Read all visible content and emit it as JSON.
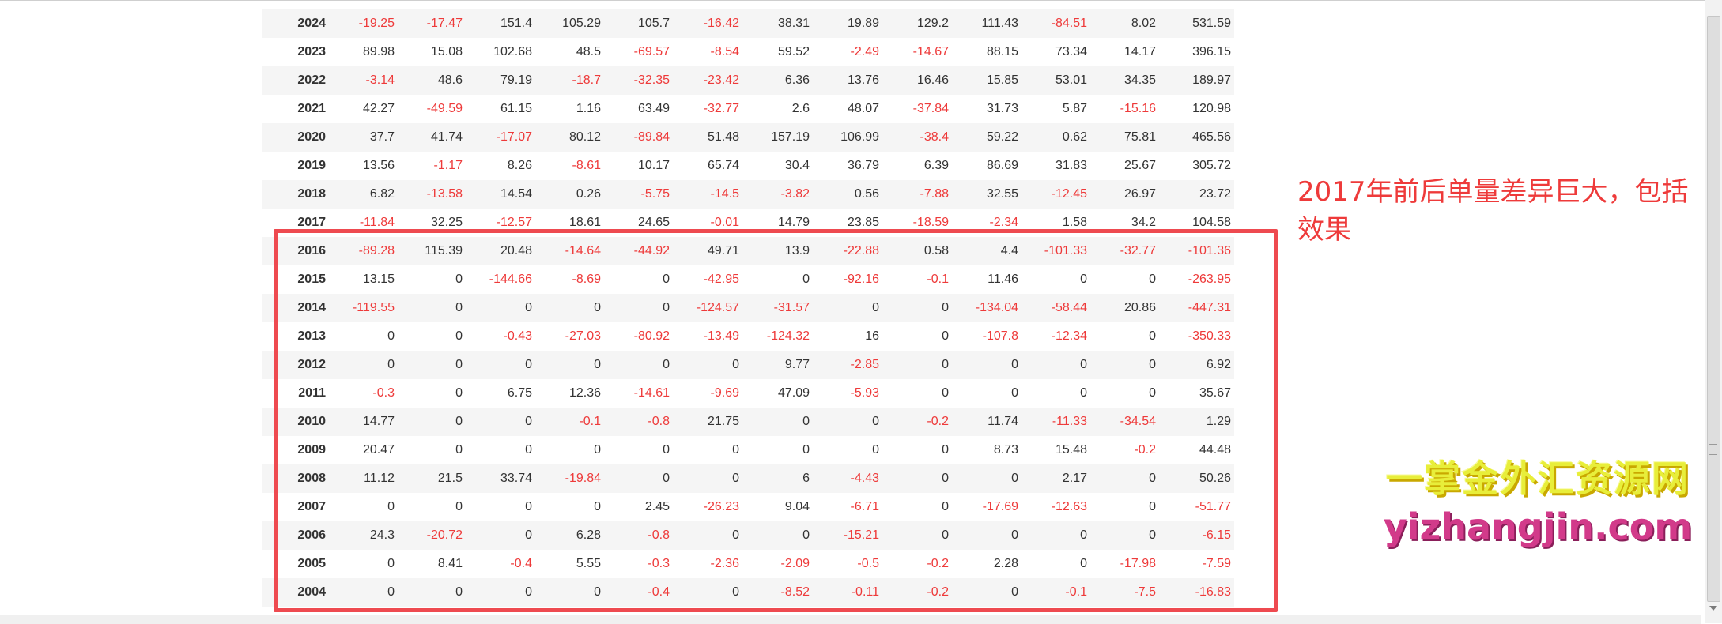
{
  "table": {
    "rows": [
      {
        "year": "2024",
        "values": [
          "-19.25",
          "-17.47",
          "151.4",
          "105.29",
          "105.7",
          "-16.42",
          "38.31",
          "19.89",
          "129.2",
          "111.43",
          "-84.51",
          "8.02",
          "531.59"
        ]
      },
      {
        "year": "2023",
        "values": [
          "89.98",
          "15.08",
          "102.68",
          "48.5",
          "-69.57",
          "-8.54",
          "59.52",
          "-2.49",
          "-14.67",
          "88.15",
          "73.34",
          "14.17",
          "396.15"
        ]
      },
      {
        "year": "2022",
        "values": [
          "-3.14",
          "48.6",
          "79.19",
          "-18.7",
          "-32.35",
          "-23.42",
          "6.36",
          "13.76",
          "16.46",
          "15.85",
          "53.01",
          "34.35",
          "189.97"
        ]
      },
      {
        "year": "2021",
        "values": [
          "42.27",
          "-49.59",
          "61.15",
          "1.16",
          "63.49",
          "-32.77",
          "2.6",
          "48.07",
          "-37.84",
          "31.73",
          "5.87",
          "-15.16",
          "120.98"
        ]
      },
      {
        "year": "2020",
        "values": [
          "37.7",
          "41.74",
          "-17.07",
          "80.12",
          "-89.84",
          "51.48",
          "157.19",
          "106.99",
          "-38.4",
          "59.22",
          "0.62",
          "75.81",
          "465.56"
        ]
      },
      {
        "year": "2019",
        "values": [
          "13.56",
          "-1.17",
          "8.26",
          "-8.61",
          "10.17",
          "65.74",
          "30.4",
          "36.79",
          "6.39",
          "86.69",
          "31.83",
          "25.67",
          "305.72"
        ]
      },
      {
        "year": "2018",
        "values": [
          "6.82",
          "-13.58",
          "14.54",
          "0.26",
          "-5.75",
          "-14.5",
          "-3.82",
          "0.56",
          "-7.88",
          "32.55",
          "-12.45",
          "26.97",
          "23.72"
        ]
      },
      {
        "year": "2017",
        "values": [
          "-11.84",
          "32.25",
          "-12.57",
          "18.61",
          "24.65",
          "-0.01",
          "14.79",
          "23.85",
          "-18.59",
          "-2.34",
          "1.58",
          "34.2",
          "104.58"
        ]
      },
      {
        "year": "2016",
        "values": [
          "-89.28",
          "115.39",
          "20.48",
          "-14.64",
          "-44.92",
          "49.71",
          "13.9",
          "-22.88",
          "0.58",
          "4.4",
          "-101.33",
          "-32.77",
          "-101.36"
        ]
      },
      {
        "year": "2015",
        "values": [
          "13.15",
          "0",
          "-144.66",
          "-8.69",
          "0",
          "-42.95",
          "0",
          "-92.16",
          "-0.1",
          "11.46",
          "0",
          "0",
          "-263.95"
        ]
      },
      {
        "year": "2014",
        "values": [
          "-119.55",
          "0",
          "0",
          "0",
          "0",
          "-124.57",
          "-31.57",
          "0",
          "0",
          "-134.04",
          "-58.44",
          "20.86",
          "-447.31"
        ]
      },
      {
        "year": "2013",
        "values": [
          "0",
          "0",
          "-0.43",
          "-27.03",
          "-80.92",
          "-13.49",
          "-124.32",
          "16",
          "0",
          "-107.8",
          "-12.34",
          "0",
          "-350.33"
        ]
      },
      {
        "year": "2012",
        "values": [
          "0",
          "0",
          "0",
          "0",
          "0",
          "0",
          "9.77",
          "-2.85",
          "0",
          "0",
          "0",
          "0",
          "6.92"
        ]
      },
      {
        "year": "2011",
        "values": [
          "-0.3",
          "0",
          "6.75",
          "12.36",
          "-14.61",
          "-9.69",
          "47.09",
          "-5.93",
          "0",
          "0",
          "0",
          "0",
          "35.67"
        ]
      },
      {
        "year": "2010",
        "values": [
          "14.77",
          "0",
          "0",
          "-0.1",
          "-0.8",
          "21.75",
          "0",
          "0",
          "-0.2",
          "11.74",
          "-11.33",
          "-34.54",
          "1.29"
        ]
      },
      {
        "year": "2009",
        "values": [
          "20.47",
          "0",
          "0",
          "0",
          "0",
          "0",
          "0",
          "0",
          "0",
          "8.73",
          "15.48",
          "-0.2",
          "44.48"
        ]
      },
      {
        "year": "2008",
        "values": [
          "11.12",
          "21.5",
          "33.74",
          "-19.84",
          "0",
          "0",
          "6",
          "-4.43",
          "0",
          "0",
          "2.17",
          "0",
          "50.26"
        ]
      },
      {
        "year": "2007",
        "values": [
          "0",
          "0",
          "0",
          "0",
          "2.45",
          "-26.23",
          "9.04",
          "-6.71",
          "0",
          "-17.69",
          "-12.63",
          "0",
          "-51.77"
        ]
      },
      {
        "year": "2006",
        "values": [
          "24.3",
          "-20.72",
          "0",
          "6.28",
          "-0.8",
          "0",
          "0",
          "-15.21",
          "0",
          "0",
          "0",
          "0",
          "-6.15"
        ]
      },
      {
        "year": "2005",
        "values": [
          "0",
          "8.41",
          "-0.4",
          "5.55",
          "-0.3",
          "-2.36",
          "-2.09",
          "-0.5",
          "-0.2",
          "2.28",
          "0",
          "-17.98",
          "-7.59"
        ]
      },
      {
        "year": "2004",
        "values": [
          "0",
          "0",
          "0",
          "0",
          "-0.4",
          "0",
          "-8.52",
          "-0.11",
          "-0.2",
          "0",
          "-0.1",
          "-7.5",
          "-16.83"
        ]
      }
    ]
  },
  "annotation": {
    "line1": "2017年前后单量差异巨大，包括",
    "line2": "效果",
    "color": "#ee3a3a"
  },
  "watermark": {
    "line1": "一掌金外汇资源网",
    "line2": "yizhangjin.com"
  },
  "colors": {
    "negative": "#ee3a3a",
    "positive": "#333333",
    "highlight_border": "#ee4a50"
  }
}
